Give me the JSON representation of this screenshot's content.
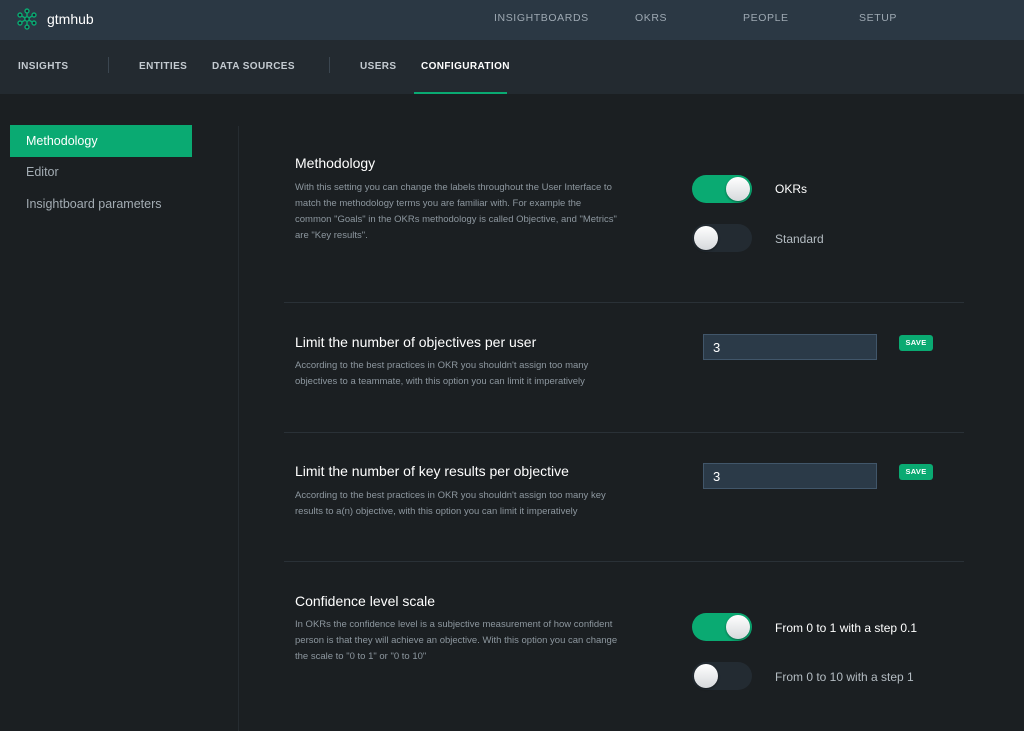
{
  "topbar": {
    "app_name": "gtmhub",
    "nav": [
      "INSIGHTBOARDS",
      "OKRS",
      "PEOPLE",
      "SETUP"
    ]
  },
  "subnav": {
    "items": [
      "INSIGHTS",
      "ENTITIES",
      "DATA SOURCES",
      "USERS",
      "CONFIGURATION"
    ],
    "active": "CONFIGURATION"
  },
  "sidebar": {
    "items": [
      "Methodology",
      "Editor",
      "Insightboard parameters"
    ],
    "active": "Methodology"
  },
  "sections": {
    "methodology": {
      "title": "Methodology",
      "description": "With this setting you can change the labels throughout the User Interface to match the methodology terms you are familiar with. For example the common \"Goals\" in the OKRs methodology is called Objective, and \"Metrics\" are \"Key results\".",
      "options": [
        {
          "label": "OKRs",
          "enabled": true
        },
        {
          "label": "Standard",
          "enabled": false
        }
      ]
    },
    "objectives_limit": {
      "title": "Limit the number of objectives per user",
      "description": "According to the best practices in OKR you shouldn't assign too many objectives to a teammate, with this option you can limit it imperatively",
      "value": "3",
      "save_label": "SAVE"
    },
    "key_results_limit": {
      "title": "Limit the number of key results per objective",
      "description": "According to the best practices in OKR you shouldn't assign too many key results to a(n) objective, with this option you can limit it imperatively",
      "value": "3",
      "save_label": "SAVE"
    },
    "confidence": {
      "title": "Confidence level scale",
      "description": "In OKRs the confidence level is a subjective measurement of how confident person is that they will achieve an objective. With this option you can change the scale to \"0 to 1\" or \"0 to 10\"",
      "options": [
        {
          "label": "From 0 to 1 with a step 0.1",
          "enabled": true
        },
        {
          "label": "From 0 to 10 with a step 1",
          "enabled": false
        }
      ]
    }
  },
  "colors": {
    "accent": "#0aaa72",
    "topbar": "#2b3844",
    "subnav": "#232a30",
    "background": "#1b1f22"
  },
  "icons": {
    "logo": "network-nodes-icon"
  }
}
